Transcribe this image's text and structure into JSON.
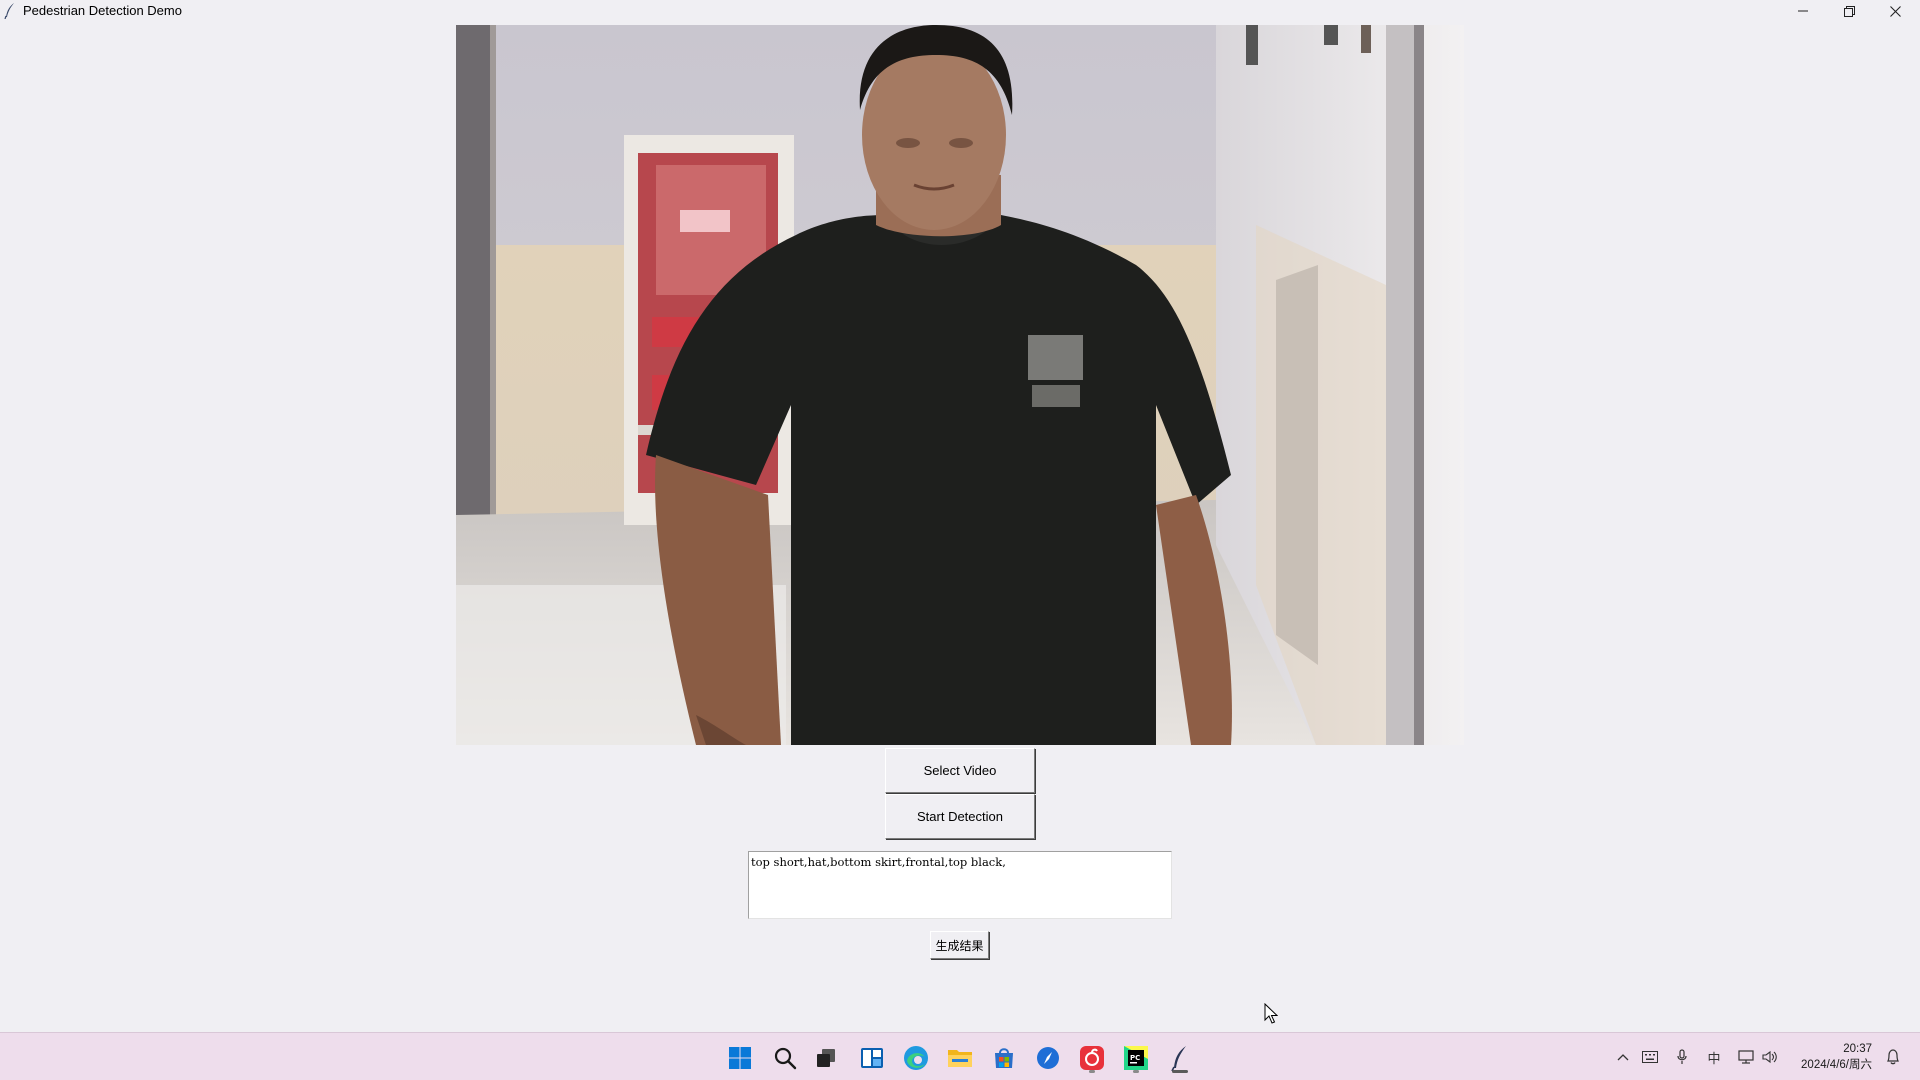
{
  "window": {
    "title": "Pedestrian Detection Demo",
    "minimize_icon": "minimize-icon",
    "restore_icon": "restore-icon",
    "close_icon": "close-icon"
  },
  "video": {
    "description_icon": "video-frame"
  },
  "buttons": {
    "select_video": "Select Video",
    "start_detection": "Start Detection",
    "generate": "生成结果"
  },
  "output": {
    "text": "top short,hat,bottom skirt,frontal,top black,"
  },
  "taskbar": {
    "apps": [
      {
        "name": "start",
        "icon": "windows-start-icon"
      },
      {
        "name": "search",
        "icon": "search-icon"
      },
      {
        "name": "task-view",
        "icon": "task-view-icon"
      },
      {
        "name": "widgets",
        "icon": "widgets-icon"
      },
      {
        "name": "edge",
        "icon": "edge-browser-icon"
      },
      {
        "name": "file-explorer",
        "icon": "folder-icon"
      },
      {
        "name": "store",
        "icon": "store-icon"
      },
      {
        "name": "app-blue",
        "icon": "compass-app-icon"
      },
      {
        "name": "netease-music",
        "icon": "music-app-icon"
      },
      {
        "name": "pycharm",
        "icon": "pycharm-icon"
      },
      {
        "name": "python-tk",
        "icon": "feather-app-icon"
      }
    ],
    "tray": {
      "input_method": "中",
      "time": "20:37",
      "date": "2024/4/6/周六"
    }
  },
  "colors": {
    "window_bg": "#f0eff3",
    "taskbar_bg": "#eeddec",
    "win_blue": "#0078d4"
  }
}
